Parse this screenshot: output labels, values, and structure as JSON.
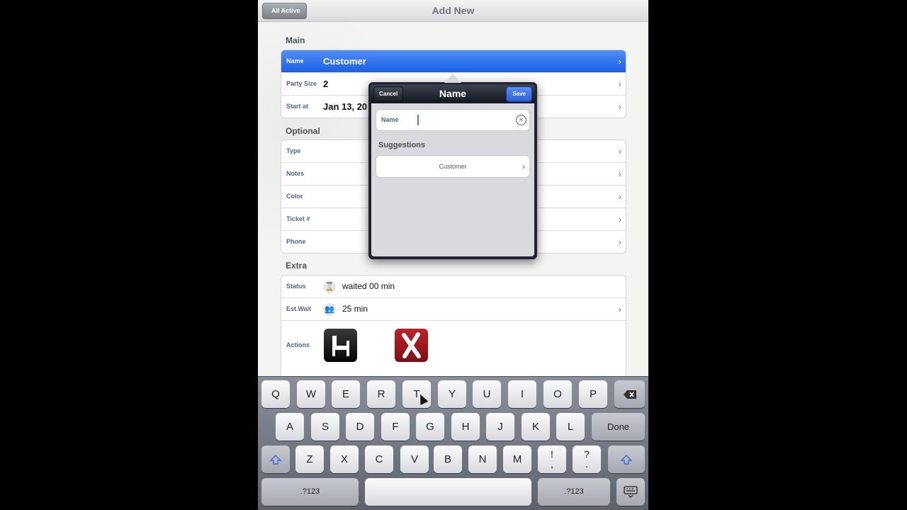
{
  "navbar": {
    "back_label": "All Active",
    "title": "Add New"
  },
  "sections": {
    "main": "Main",
    "optional": "Optional",
    "extra": "Extra"
  },
  "main_rows": [
    {
      "label": "Name",
      "value": "Customer"
    },
    {
      "label": "Party Size",
      "value": "2"
    },
    {
      "label": "Start at",
      "value": "Jan 13, 20"
    }
  ],
  "optional_rows": [
    "Type",
    "Notes",
    "Color",
    "Ticket #",
    "Phone"
  ],
  "extra_rows": {
    "status_label": "Status",
    "status_value": "waited 00 min",
    "wait_label": "Est.Wait",
    "wait_value": "25 min",
    "actions_label": "Actions"
  },
  "popover": {
    "title": "Name",
    "cancel_label": "Cancel",
    "save_label": "Save",
    "field_label": "Name",
    "field_value": "",
    "suggestions_title": "Suggestions",
    "suggestions": [
      "Customer"
    ]
  },
  "keyboard": {
    "row1": [
      "Q",
      "W",
      "E",
      "R",
      "T",
      "Y",
      "U",
      "I",
      "O",
      "P"
    ],
    "row2": [
      "A",
      "S",
      "D",
      "F",
      "G",
      "H",
      "J",
      "K",
      "L"
    ],
    "row3": [
      "Z",
      "X",
      "C",
      "V",
      "B",
      "N",
      "M"
    ],
    "done_label": "Done",
    "num_label": ".?123",
    "excl_top": "!",
    "excl_bottom": ",",
    "q_top": "?",
    "q_bottom": "."
  },
  "colors": {
    "selected_row": "#1c5fe6",
    "save_button": "#2a5fda",
    "label_blue": "#4f6489"
  },
  "icons": {
    "back": "chevron-left-icon",
    "disclosure": "chevron-right-icon",
    "clear": "clear-circle-icon",
    "status": "hourglass-icon",
    "wait": "people-icon",
    "seat": "chair-icon",
    "cancel_action": "x-mark-icon",
    "backspace": "backspace-icon",
    "shift": "shift-arrow-icon",
    "hide_keyboard": "keyboard-hide-icon"
  }
}
